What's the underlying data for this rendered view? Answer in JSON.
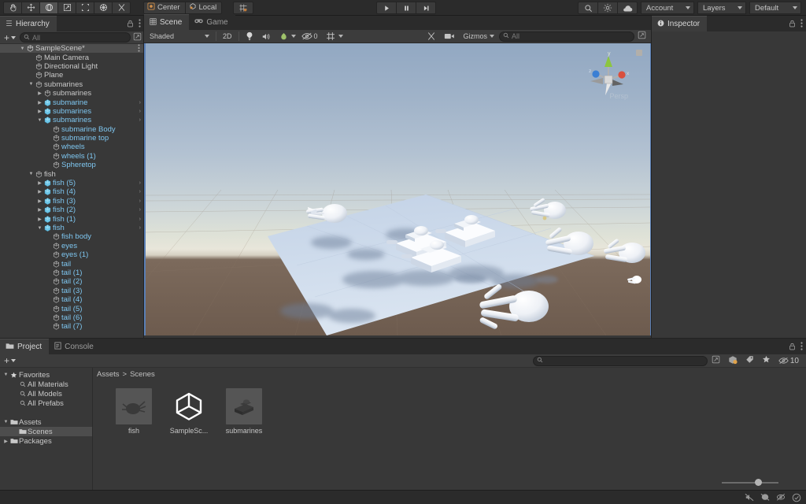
{
  "app": {
    "title": "Unity Editor"
  },
  "toolbar": {
    "tools": [
      {
        "name": "hand-tool",
        "glyph": "hand",
        "active": false
      },
      {
        "name": "move-tool",
        "glyph": "move",
        "active": false
      },
      {
        "name": "rotate-tool",
        "glyph": "rotate",
        "active": true
      },
      {
        "name": "scale-tool",
        "glyph": "scale",
        "active": false
      },
      {
        "name": "rect-tool",
        "glyph": "rect",
        "active": false
      },
      {
        "name": "transform-tool",
        "glyph": "transform",
        "active": false
      },
      {
        "name": "custom-tool",
        "glyph": "wrench",
        "active": false
      }
    ],
    "pivot_label": "Center",
    "handle_label": "Local",
    "snap_label": "",
    "play": "▶",
    "pause": "❙❙",
    "step": "▶|",
    "search_label": "",
    "cloud_label": "",
    "account_label": "Account",
    "layers_label": "Layers",
    "layout_label": "Default"
  },
  "hierarchy": {
    "tab_label": "Hierarchy",
    "add_label": "+",
    "search_placeholder": "All",
    "items": [
      {
        "label": "SampleScene*",
        "depth": 0,
        "icon": "scene-icon",
        "expanded": true,
        "selected": true,
        "prefab": false,
        "kebab": true
      },
      {
        "label": "Main Camera",
        "depth": 1,
        "icon": "gameobject-icon",
        "expanded": null,
        "selected": false,
        "prefab": false
      },
      {
        "label": "Directional Light",
        "depth": 1,
        "icon": "gameobject-icon",
        "expanded": null,
        "selected": false,
        "prefab": false
      },
      {
        "label": "Plane",
        "depth": 1,
        "icon": "gameobject-icon",
        "expanded": null,
        "selected": false,
        "prefab": false
      },
      {
        "label": "submarines",
        "depth": 1,
        "icon": "gameobject-icon",
        "expanded": true,
        "selected": false,
        "prefab": false
      },
      {
        "label": "submarines",
        "depth": 2,
        "icon": "gameobject-icon",
        "expanded": false,
        "selected": false,
        "prefab": false
      },
      {
        "label": "submarine",
        "depth": 2,
        "icon": "prefab-icon",
        "expanded": false,
        "selected": false,
        "prefab": true,
        "chevron": true
      },
      {
        "label": "submarines",
        "depth": 2,
        "icon": "prefab-icon",
        "expanded": false,
        "selected": false,
        "prefab": true,
        "chevron": true
      },
      {
        "label": "submarines",
        "depth": 2,
        "icon": "prefab-icon",
        "expanded": true,
        "selected": false,
        "prefab": true,
        "chevron": true
      },
      {
        "label": "submarine Body",
        "depth": 3,
        "icon": "gameobject-icon",
        "expanded": null,
        "selected": false,
        "prefab": true
      },
      {
        "label": "submarine top",
        "depth": 3,
        "icon": "gameobject-icon",
        "expanded": null,
        "selected": false,
        "prefab": true
      },
      {
        "label": "wheels",
        "depth": 3,
        "icon": "gameobject-icon",
        "expanded": null,
        "selected": false,
        "prefab": true
      },
      {
        "label": "wheels (1)",
        "depth": 3,
        "icon": "gameobject-icon",
        "expanded": null,
        "selected": false,
        "prefab": true
      },
      {
        "label": "Spheretop",
        "depth": 3,
        "icon": "gameobject-icon",
        "expanded": null,
        "selected": false,
        "prefab": true
      },
      {
        "label": "fish",
        "depth": 1,
        "icon": "gameobject-icon",
        "expanded": true,
        "selected": false,
        "prefab": false
      },
      {
        "label": "fish (5)",
        "depth": 2,
        "icon": "prefab-icon",
        "expanded": false,
        "selected": false,
        "prefab": true,
        "chevron": true
      },
      {
        "label": "fish (4)",
        "depth": 2,
        "icon": "prefab-icon",
        "expanded": false,
        "selected": false,
        "prefab": true,
        "chevron": true
      },
      {
        "label": "fish (3)",
        "depth": 2,
        "icon": "prefab-icon",
        "expanded": false,
        "selected": false,
        "prefab": true,
        "chevron": true
      },
      {
        "label": "fish (2)",
        "depth": 2,
        "icon": "prefab-icon",
        "expanded": false,
        "selected": false,
        "prefab": true,
        "chevron": true
      },
      {
        "label": "fish (1)",
        "depth": 2,
        "icon": "prefab-icon",
        "expanded": false,
        "selected": false,
        "prefab": true,
        "chevron": true
      },
      {
        "label": "fish",
        "depth": 2,
        "icon": "prefab-icon",
        "expanded": true,
        "selected": false,
        "prefab": true,
        "chevron": true
      },
      {
        "label": "fish body",
        "depth": 3,
        "icon": "gameobject-icon",
        "expanded": null,
        "selected": false,
        "prefab": true
      },
      {
        "label": "eyes",
        "depth": 3,
        "icon": "gameobject-icon",
        "expanded": null,
        "selected": false,
        "prefab": true
      },
      {
        "label": "eyes (1)",
        "depth": 3,
        "icon": "gameobject-icon",
        "expanded": null,
        "selected": false,
        "prefab": true
      },
      {
        "label": "tail",
        "depth": 3,
        "icon": "gameobject-icon",
        "expanded": null,
        "selected": false,
        "prefab": true
      },
      {
        "label": "tail (1)",
        "depth": 3,
        "icon": "gameobject-icon",
        "expanded": null,
        "selected": false,
        "prefab": true
      },
      {
        "label": "tail (2)",
        "depth": 3,
        "icon": "gameobject-icon",
        "expanded": null,
        "selected": false,
        "prefab": true
      },
      {
        "label": "tail (3)",
        "depth": 3,
        "icon": "gameobject-icon",
        "expanded": null,
        "selected": false,
        "prefab": true
      },
      {
        "label": "tail (4)",
        "depth": 3,
        "icon": "gameobject-icon",
        "expanded": null,
        "selected": false,
        "prefab": true
      },
      {
        "label": "tail (5)",
        "depth": 3,
        "icon": "gameobject-icon",
        "expanded": null,
        "selected": false,
        "prefab": true
      },
      {
        "label": "tail (6)",
        "depth": 3,
        "icon": "gameobject-icon",
        "expanded": null,
        "selected": false,
        "prefab": true
      },
      {
        "label": "tail (7)",
        "depth": 3,
        "icon": "gameobject-icon",
        "expanded": null,
        "selected": false,
        "prefab": true
      }
    ]
  },
  "scene": {
    "tabs": [
      {
        "label": "Scene",
        "icon": "scene-tab-icon",
        "selected": true
      },
      {
        "label": "Game",
        "icon": "game-tab-icon",
        "selected": false
      }
    ],
    "shading_mode": "Shaded",
    "mode_2d": "2D",
    "lighting_toggle": "light-icon",
    "audio_toggle": "audio-icon",
    "fx_label": "fx-icon",
    "hidden_count": "0",
    "grid_label": "grid-icon",
    "gizmos_label": "Gizmos",
    "search_placeholder": "All",
    "projection_label": "Persp",
    "gizmo_axes": {
      "x": "x",
      "y": "y",
      "z": "z"
    }
  },
  "inspector": {
    "tab_label": "Inspector",
    "lock_icon": "lock-icon",
    "menu_icon": "kebab-icon"
  },
  "project": {
    "tabs": [
      {
        "label": "Project",
        "icon": "project-tab-icon",
        "selected": true
      },
      {
        "label": "Console",
        "icon": "console-tab-icon",
        "selected": false
      }
    ],
    "add_label": "+",
    "search_placeholder": "",
    "favorites_count": "10",
    "tree": [
      {
        "label": "Favorites",
        "depth": 0,
        "icon": "star-icon",
        "expanded": true,
        "selected": false
      },
      {
        "label": "All Materials",
        "depth": 1,
        "icon": "search-small-icon",
        "expanded": null,
        "selected": false
      },
      {
        "label": "All Models",
        "depth": 1,
        "icon": "search-small-icon",
        "expanded": null,
        "selected": false
      },
      {
        "label": "All Prefabs",
        "depth": 1,
        "icon": "search-small-icon",
        "expanded": null,
        "selected": false
      },
      {
        "label": "",
        "depth": 0,
        "icon": "spacer",
        "expanded": null,
        "selected": false
      },
      {
        "label": "Assets",
        "depth": 0,
        "icon": "folder-icon",
        "expanded": true,
        "selected": false
      },
      {
        "label": "Scenes",
        "depth": 1,
        "icon": "folder-icon",
        "expanded": null,
        "selected": true
      },
      {
        "label": "Packages",
        "depth": 0,
        "icon": "folder-icon",
        "expanded": false,
        "selected": false
      }
    ],
    "breadcrumb": [
      "Assets",
      "Scenes"
    ],
    "assets": [
      {
        "name": "fish",
        "thumb": "fish-thumb"
      },
      {
        "name": "SampleSc...",
        "thumb": "unity-scene-thumb"
      },
      {
        "name": "submarines",
        "thumb": "submarine-thumb"
      }
    ]
  },
  "statusbar": {
    "icons": [
      "mute-audio-icon",
      "error-pause-icon",
      "no-preview-icon",
      "check-circle-icon"
    ]
  },
  "colors": {
    "panel_bg": "#383838",
    "toolbar_bg": "#2b2b2b",
    "accent_blue": "#5a7fb5",
    "prefab_blue": "#7ec6f0",
    "selection": "#4d4d4d",
    "ground": "#6d5b4e",
    "plane": "#cfdcec"
  }
}
